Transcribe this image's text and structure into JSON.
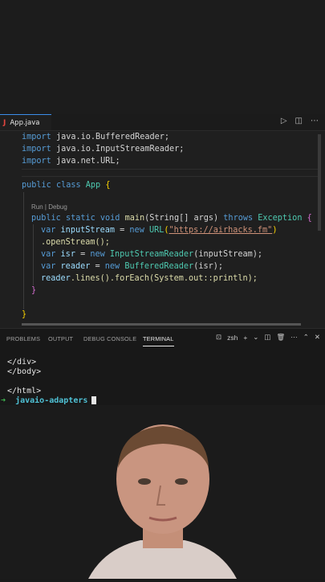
{
  "editor": {
    "tab_icon": "J",
    "tab_name": "App.java",
    "tab_actions": [
      "run-icon",
      "split-editor-icon",
      "more-icon"
    ]
  },
  "code": {
    "imports": [
      {
        "kw": "import",
        "pkg": "java.io.BufferedReader;"
      },
      {
        "kw": "import",
        "pkg": "java.io.InputStreamReader;"
      },
      {
        "kw": "import",
        "pkg": "java.net.URL;"
      }
    ],
    "class_decl": {
      "kw1": "public",
      "kw2": "class",
      "name": "App",
      "brace": "{"
    },
    "codelens": "Run | Debug",
    "main_decl": {
      "kw1": "public",
      "kw2": "static",
      "kw3": "void",
      "fn": "main",
      "params": "(String[] args)",
      "throws_kw": "throws",
      "exc": "Exception",
      "brace": "{"
    },
    "line_stream": {
      "kw": "var",
      "name": "inputStream",
      "eq": " = ",
      "new": "new",
      "type": "URL",
      "open": "(",
      "url": "\"https://airhacks.fm\"",
      "close": ")"
    },
    "line_open": ".openStream();",
    "line_isr": {
      "kw": "var",
      "name": "isr",
      "eq": " = ",
      "new": "new",
      "type": "InputStreamReader",
      "args": "(inputStream);"
    },
    "line_reader": {
      "kw": "var",
      "name": "reader",
      "eq": " = ",
      "new": "new",
      "type": "BufferedReader",
      "args": "(isr);"
    },
    "line_lines": {
      "obj": "reader",
      "rest": ".lines().forEach(System.out::println);"
    },
    "close_method": "}",
    "close_class": "}"
  },
  "panel": {
    "tabs": [
      "PROBLEMS",
      "OUTPUT",
      "DEBUG CONSOLE",
      "TERMINAL"
    ],
    "active_tab": "TERMINAL",
    "shell": "zsh"
  },
  "terminal": {
    "lines": [
      "</div>",
      "</body>",
      "",
      "</html>"
    ],
    "prompt_arrow": "➜",
    "prompt_dir": "javaio-adapters"
  }
}
